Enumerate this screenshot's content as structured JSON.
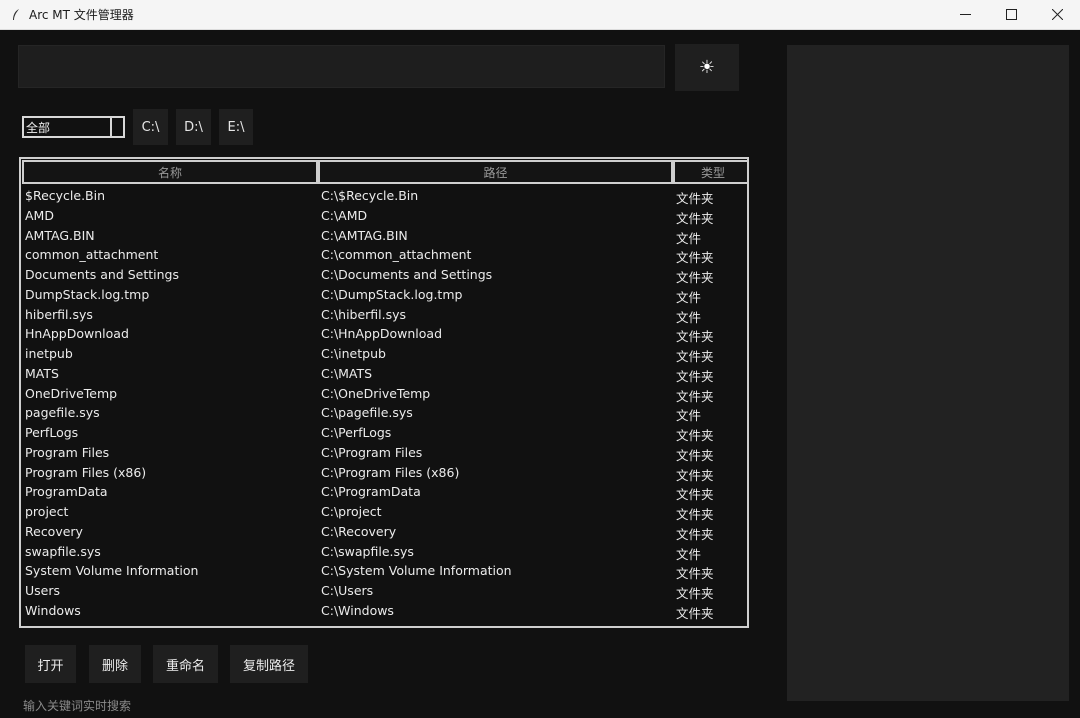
{
  "window": {
    "title": "Arc MT 文件管理器",
    "minimize_icon": "minimize-icon",
    "maximize_icon": "maximize-icon",
    "close_icon": "close-icon"
  },
  "search": {
    "value": "",
    "placeholder": ""
  },
  "theme_toggle": {
    "label": "☀",
    "icon": "sun-icon"
  },
  "filter": {
    "selected": "全部"
  },
  "drives": [
    "C:\\",
    "D:\\",
    "E:\\"
  ],
  "table": {
    "headers": {
      "name": "名称",
      "path": "路径",
      "type": "类型"
    },
    "rows": [
      {
        "name": "$Recycle.Bin",
        "path": "C:\\$Recycle.Bin",
        "type": "文件夹"
      },
      {
        "name": "AMD",
        "path": "C:\\AMD",
        "type": "文件夹"
      },
      {
        "name": "AMTAG.BIN",
        "path": "C:\\AMTAG.BIN",
        "type": "文件"
      },
      {
        "name": "common_attachment",
        "path": "C:\\common_attachment",
        "type": "文件夹"
      },
      {
        "name": "Documents and Settings",
        "path": "C:\\Documents and Settings",
        "type": "文件夹"
      },
      {
        "name": "DumpStack.log.tmp",
        "path": "C:\\DumpStack.log.tmp",
        "type": "文件"
      },
      {
        "name": "hiberfil.sys",
        "path": "C:\\hiberfil.sys",
        "type": "文件"
      },
      {
        "name": "HnAppDownload",
        "path": "C:\\HnAppDownload",
        "type": "文件夹"
      },
      {
        "name": "inetpub",
        "path": "C:\\inetpub",
        "type": "文件夹"
      },
      {
        "name": "MATS",
        "path": "C:\\MATS",
        "type": "文件夹"
      },
      {
        "name": "OneDriveTemp",
        "path": "C:\\OneDriveTemp",
        "type": "文件夹"
      },
      {
        "name": "pagefile.sys",
        "path": "C:\\pagefile.sys",
        "type": "文件"
      },
      {
        "name": "PerfLogs",
        "path": "C:\\PerfLogs",
        "type": "文件夹"
      },
      {
        "name": "Program Files",
        "path": "C:\\Program Files",
        "type": "文件夹"
      },
      {
        "name": "Program Files (x86)",
        "path": "C:\\Program Files (x86)",
        "type": "文件夹"
      },
      {
        "name": "ProgramData",
        "path": "C:\\ProgramData",
        "type": "文件夹"
      },
      {
        "name": "project",
        "path": "C:\\project",
        "type": "文件夹"
      },
      {
        "name": "Recovery",
        "path": "C:\\Recovery",
        "type": "文件夹"
      },
      {
        "name": "swapfile.sys",
        "path": "C:\\swapfile.sys",
        "type": "文件"
      },
      {
        "name": "System Volume Information",
        "path": "C:\\System Volume Information",
        "type": "文件夹"
      },
      {
        "name": "Users",
        "path": "C:\\Users",
        "type": "文件夹"
      },
      {
        "name": "Windows",
        "path": "C:\\Windows",
        "type": "文件夹"
      }
    ]
  },
  "actions": {
    "open": "打开",
    "delete": "删除",
    "rename": "重命名",
    "copy_path": "复制路径"
  },
  "status": "输入关键词实时搜索"
}
